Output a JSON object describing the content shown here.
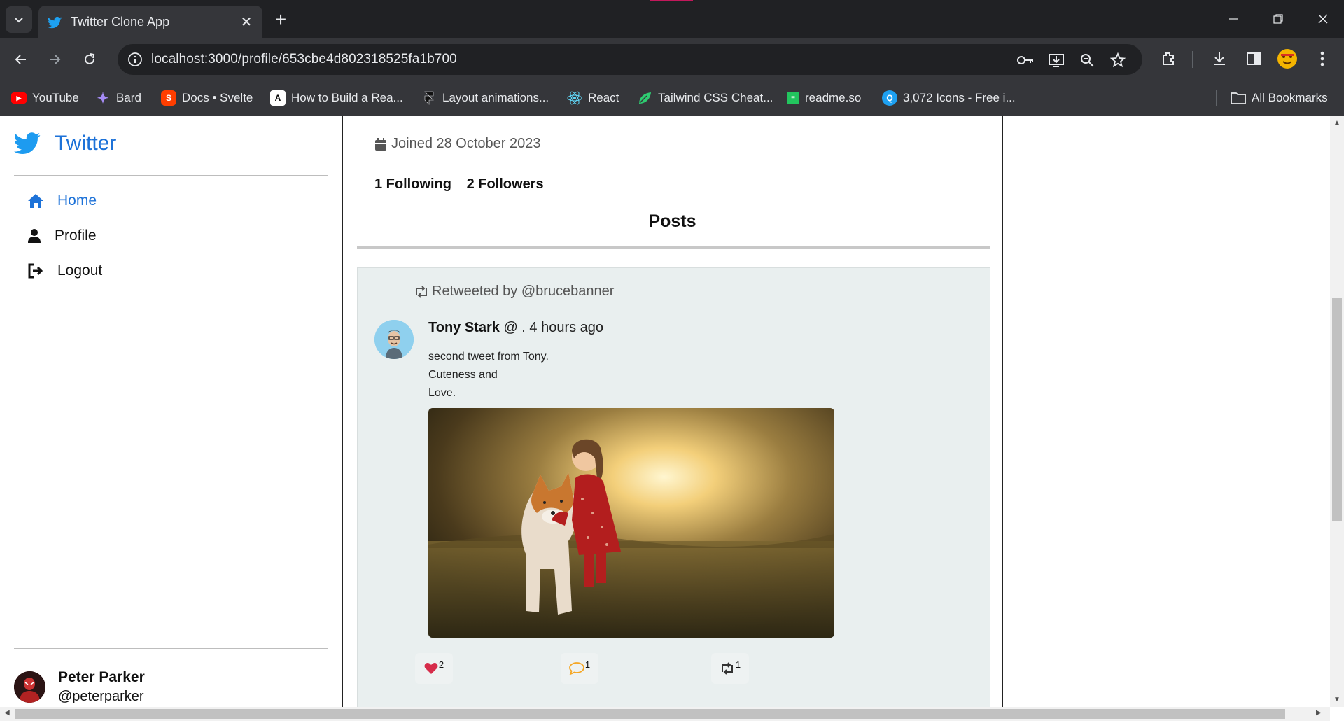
{
  "browser": {
    "tab_title": "Twitter Clone App",
    "url": "localhost:3000/profile/653cbe4d802318525fa1b700",
    "bookmarks": [
      {
        "label": "YouTube",
        "icon": "youtube-icon",
        "color": "#ff0000"
      },
      {
        "label": "Bard",
        "icon": "bard-icon",
        "color": "#8ab4f8"
      },
      {
        "label": "Docs • Svelte",
        "icon": "svelte-icon",
        "color": "#ff3e00"
      },
      {
        "label": "How to Build a Rea...",
        "icon": "site-icon",
        "color": "#ffffff"
      },
      {
        "label": "Layout animations...",
        "icon": "framer-icon",
        "color": "#ffffff"
      },
      {
        "label": "React",
        "icon": "react-icon",
        "color": "#61dafb"
      },
      {
        "label": "Tailwind CSS Cheat...",
        "icon": "tailwind-leaf-icon",
        "color": "#2ecc71"
      },
      {
        "label": "readme.so",
        "icon": "readme-icon",
        "color": "#22c55e"
      },
      {
        "label": "3,072 Icons - Free i...",
        "icon": "search-circle-icon",
        "color": "#1ea1f2"
      }
    ],
    "all_bookmarks": "All Bookmarks"
  },
  "sidebar": {
    "brand": "Twitter",
    "nav": [
      {
        "label": "Home",
        "icon": "home-icon",
        "active": true
      },
      {
        "label": "Profile",
        "icon": "user-icon",
        "active": false
      },
      {
        "label": "Logout",
        "icon": "logout-icon",
        "active": false
      }
    ],
    "user": {
      "name": "Peter Parker",
      "handle": "@peterparker"
    }
  },
  "profile": {
    "joined": "Joined 28 October 2023",
    "following": "1 Following",
    "followers": "2 Followers",
    "posts_heading": "Posts"
  },
  "post": {
    "retweeted_by": "Retweeted by @brucebanner",
    "author": "Tony Stark",
    "meta": "@ . 4 hours ago",
    "lines": [
      "second tweet from Tony.",
      "Cuteness and",
      "Love."
    ],
    "likes": "2",
    "comments": "1",
    "retweets": "1"
  },
  "colors": {
    "accent": "#1d72d8",
    "like": "#e0245e",
    "comment": "#f5a623",
    "card_bg": "#e9efef"
  }
}
